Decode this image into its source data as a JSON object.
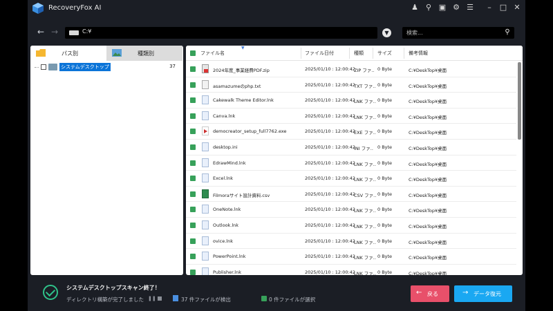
{
  "app": {
    "title": "RecoveryFox AI"
  },
  "titlebar_icons": [
    "user-icon",
    "cart-icon",
    "chat-icon",
    "gear-icon",
    "menu-icon"
  ],
  "window_controls": [
    "minimize",
    "maximize",
    "close"
  ],
  "address": {
    "path": "C:¥",
    "search_placeholder": "検索..."
  },
  "tabs": [
    {
      "label": "パス別",
      "active": true
    },
    {
      "label": "種類別",
      "active": false
    }
  ],
  "tree": {
    "label": "システムデスクトップ",
    "count": "37"
  },
  "table": {
    "columns": [
      "ファイル名",
      "ファイル日付",
      "種類",
      "サイズ",
      "備考情報"
    ],
    "rows": [
      {
        "name": "2024年度_事業経費PDF.zip",
        "date": "2025/01/10 : 12:00:42",
        "type": "ZIP ファ..",
        "size": "0 Byte",
        "note": "C:¥DeskTop¥桌面",
        "icon": "zip"
      },
      {
        "name": "asamazumeのphp.txt",
        "date": "2025/01/10 : 12:00:42",
        "type": "TXT ファ..",
        "size": "0 Byte",
        "note": "C:¥DeskTop¥桌面",
        "icon": "txt"
      },
      {
        "name": "Cakewalk Theme Editor.lnk",
        "date": "2025/01/10 : 12:00:42",
        "type": "LNK ファ..",
        "size": "0 Byte",
        "note": "C:¥DeskTop¥桌面",
        "icon": "lnk"
      },
      {
        "name": "Canva.lnk",
        "date": "2025/01/10 : 12:00:42",
        "type": "LNK ファ..",
        "size": "0 Byte",
        "note": "C:¥DeskTop¥桌面",
        "icon": "lnk"
      },
      {
        "name": "democreator_setup_full7762.exe",
        "date": "2025/01/10 : 12:00:42",
        "type": "EXE ファ..",
        "size": "0 Byte",
        "note": "C:¥DeskTop¥桌面",
        "icon": "exe"
      },
      {
        "name": "desktop.ini",
        "date": "2025/01/10 : 12:00:42",
        "type": "INI ファ..",
        "size": "0 Byte",
        "note": "C:¥DeskTop¥桌面",
        "icon": "lnk"
      },
      {
        "name": "EdrawMind.lnk",
        "date": "2025/01/10 : 12:00:42",
        "type": "LNK ファ..",
        "size": "0 Byte",
        "note": "C:¥DeskTop¥桌面",
        "icon": "lnk"
      },
      {
        "name": "Excel.lnk",
        "date": "2025/01/10 : 12:00:42",
        "type": "LNK ファ..",
        "size": "0 Byte",
        "note": "C:¥DeskTop¥桌面",
        "icon": "lnk"
      },
      {
        "name": "Filmoraサイト設計資料.csv",
        "date": "2025/01/10 : 12:00:42",
        "type": "CSV ファ..",
        "size": "0 Byte",
        "note": "C:¥DeskTop¥桌面",
        "icon": "csv"
      },
      {
        "name": "OneNote.lnk",
        "date": "2025/01/10 : 12:00:42",
        "type": "LNK ファ..",
        "size": "0 Byte",
        "note": "C:¥DeskTop¥桌面",
        "icon": "lnk"
      },
      {
        "name": "Outlook.lnk",
        "date": "2025/01/10 : 12:00:42",
        "type": "LNK ファ..",
        "size": "0 Byte",
        "note": "C:¥DeskTop¥桌面",
        "icon": "lnk"
      },
      {
        "name": "ovice.lnk",
        "date": "2025/01/10 : 12:00:42",
        "type": "LNK ファ..",
        "size": "0 Byte",
        "note": "C:¥DeskTop¥桌面",
        "icon": "lnk"
      },
      {
        "name": "PowerPoint.lnk",
        "date": "2025/01/10 : 12:00:42",
        "type": "LNK ファ..",
        "size": "0 Byte",
        "note": "C:¥DeskTop¥桌面",
        "icon": "lnk"
      },
      {
        "name": "Publisher.lnk",
        "date": "2025/01/10 : 12:00:42",
        "type": "LNK ファ..",
        "size": "0 Byte",
        "note": "C:¥DeskTop¥桌面",
        "icon": "lnk"
      }
    ]
  },
  "status": {
    "title": "システムデスクトップスキャン終了！",
    "subtitle": "ディレクトリ構築が完了しました",
    "found": "37 件ファイルが検出",
    "selected": "0 件ファイルが選択"
  },
  "buttons": {
    "back": "戻る",
    "recover": "データ復元"
  },
  "colors": {
    "accent_green": "#37a15a",
    "back_button": "#e8506a",
    "recover_button": "#1aa8f2",
    "selection": "#0b74d8"
  }
}
